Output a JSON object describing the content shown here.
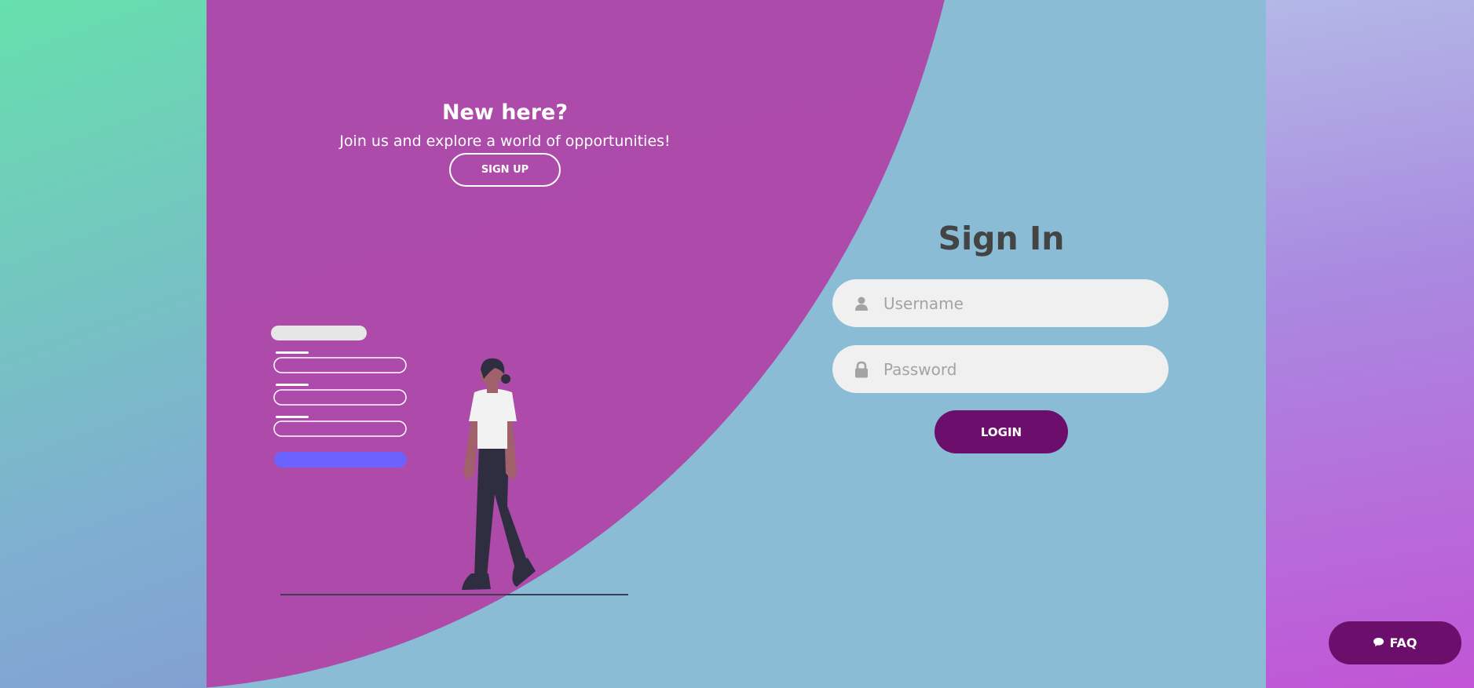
{
  "panel": {
    "heading": "New here?",
    "subtitle": "Join us and explore a world of opportunities!",
    "signup_label": "SIGN UP"
  },
  "signin": {
    "title": "Sign In",
    "username_placeholder": "Username",
    "password_placeholder": "Password",
    "login_label": "LOGIN"
  },
  "faq": {
    "label": "FAQ",
    "icon": "comment-icon"
  },
  "colors": {
    "accent": "#6c0f6c",
    "panel_bg": "#8abcd6",
    "blob": "#ab4bab"
  },
  "icons": [
    "user-icon",
    "lock-icon",
    "comment-icon"
  ]
}
